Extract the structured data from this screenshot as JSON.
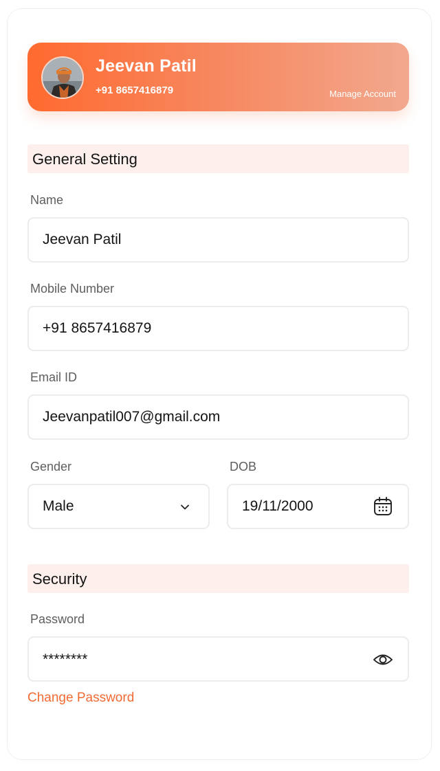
{
  "profile": {
    "name": "Jeevan Patil",
    "phone": "+91 8657416879",
    "manage_account": "Manage Account"
  },
  "general_setting": {
    "title": "General Setting",
    "name": {
      "label": "Name",
      "value": "Jeevan Patil"
    },
    "mobile": {
      "label": "Mobile Number",
      "value": "+91 8657416879"
    },
    "email": {
      "label": "Email ID",
      "value": "Jeevanpatil007@gmail.com"
    },
    "gender": {
      "label": "Gender",
      "value": "Male",
      "icon": "chevron-down-icon"
    },
    "dob": {
      "label": "DOB",
      "value": "19/11/2000",
      "icon": "calendar-icon"
    }
  },
  "security": {
    "title": "Security",
    "password": {
      "label": "Password",
      "value": "********",
      "icon": "eye-icon"
    },
    "change_password": "Change Password"
  },
  "colors": {
    "accent": "#f26a33",
    "section_background": "#fdf0ec",
    "field_border": "#ececec"
  }
}
